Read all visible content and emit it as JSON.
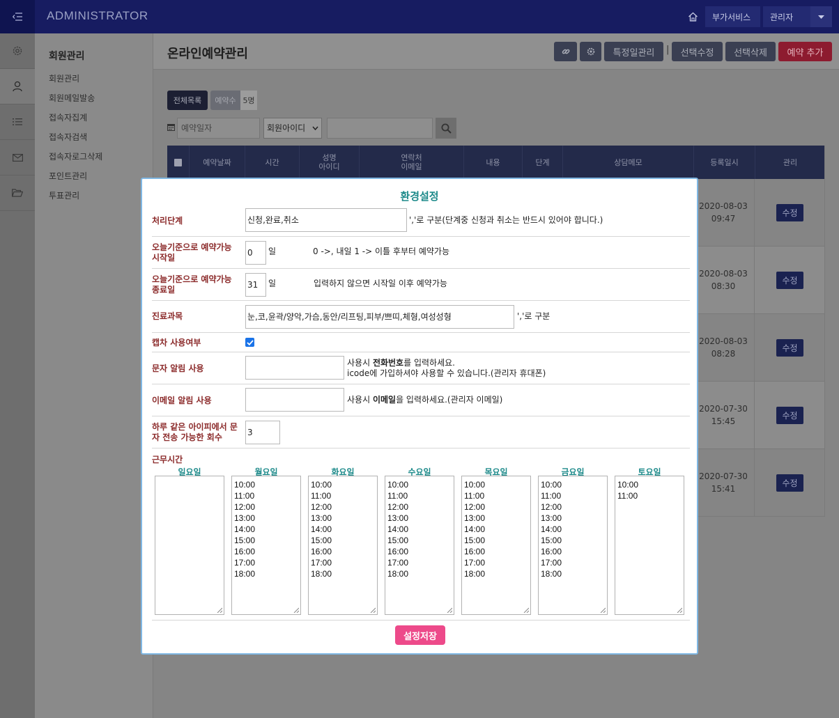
{
  "topbar": {
    "brand": "ADMINISTRATOR",
    "addon_label": "부가서비스",
    "admin_label": "관리자"
  },
  "submenu": {
    "title": "회원관리",
    "items": [
      "회원관리",
      "회원메일발송",
      "접속자집계",
      "접속자검색",
      "접속자로그삭제",
      "포인트관리",
      "투표관리"
    ]
  },
  "page": {
    "title": "온라인예약관리",
    "buttons": {
      "special_day": "특정일관리",
      "separator": "|",
      "edit_selected": "선택수정",
      "delete_selected": "선택삭제",
      "add_reservation": "예약 추가"
    }
  },
  "filter": {
    "all_label": "전체목록",
    "count_label": "예약수",
    "count_value": "5명",
    "date_placeholder": "예약일자",
    "member_select": "회원아이디"
  },
  "table": {
    "headers": [
      "예약날짜",
      "시간",
      "성명\n아이디",
      "연락처\n이메일",
      "내용",
      "단계",
      "상담메모",
      "등록일시",
      "관리"
    ],
    "rows": [
      {
        "date": "2020-08-03",
        "time": "09:47",
        "action": "수정"
      },
      {
        "date": "2020-08-03",
        "time": "08:30",
        "action": "수정"
      },
      {
        "date": "2020-08-03",
        "time": "08:28",
        "action": "수정"
      },
      {
        "date": "2020-07-30",
        "time": "15:45",
        "action": "수정"
      },
      {
        "date": "2020-07-30",
        "time": "15:41",
        "action": "수정"
      }
    ]
  },
  "modal": {
    "title": "환경설정",
    "steps": {
      "label": "처리단계",
      "value": "신청,완료,취소",
      "desc": "','로 구분(단계중 신청과 취소는 반드시 있어야 합니다.)"
    },
    "start_day": {
      "label": "오늘기준으로 예약가능 시작일",
      "value": "0",
      "unit": "일",
      "desc": "0 ->, 내일 1 -> 이틀 후부터 예약가능"
    },
    "end_day": {
      "label": "오늘기준으로 예약가능 종료일",
      "value": "31",
      "unit": "일",
      "desc": "입력하지 않으면 시작일 이후 예약가능"
    },
    "departments": {
      "label": "진료과목",
      "value": "눈,코,윤곽/양악,가슴,동안/리프팅,피부/쁘띠,체형,여성성형",
      "desc": "','로 구분"
    },
    "captcha": {
      "label": "캡차 사용여부",
      "checked": true
    },
    "sms": {
      "label": "문자 알림 사용",
      "value": "",
      "desc_pre": "사용시 ",
      "desc_bold": "전화번호",
      "desc_post": "를 입력하세요.",
      "desc2": "icode에 가입하셔야 사용할 수 있습니다.(관리자 휴대폰)"
    },
    "email": {
      "label": "이메일 알림 사용",
      "value": "",
      "desc_pre": "사용시 ",
      "desc_bold": "이메일",
      "desc_post": "을 입력하세요.(관리자 이메일)"
    },
    "sms_limit": {
      "label": "하루 같은 아이피에서 문자 전송 가능한 회수",
      "value": "3"
    },
    "work_hours": {
      "label": "근무시간",
      "days": [
        {
          "name": "일요일",
          "times": ""
        },
        {
          "name": "월요일",
          "times": "10:00\n11:00\n12:00\n13:00\n14:00\n15:00\n16:00\n17:00\n18:00"
        },
        {
          "name": "화요일",
          "times": "10:00\n11:00\n12:00\n13:00\n14:00\n15:00\n16:00\n17:00\n18:00"
        },
        {
          "name": "수요일",
          "times": "10:00\n11:00\n12:00\n13:00\n14:00\n15:00\n16:00\n17:00\n18:00"
        },
        {
          "name": "목요일",
          "times": "10:00\n11:00\n12:00\n13:00\n14:00\n15:00\n16:00\n17:00\n18:00"
        },
        {
          "name": "금요일",
          "times": "10:00\n11:00\n12:00\n13:00\n14:00\n15:00\n16:00\n17:00\n18:00"
        },
        {
          "name": "토요일",
          "times": "10:00\n11:00"
        }
      ]
    },
    "save_label": "설정저장"
  }
}
